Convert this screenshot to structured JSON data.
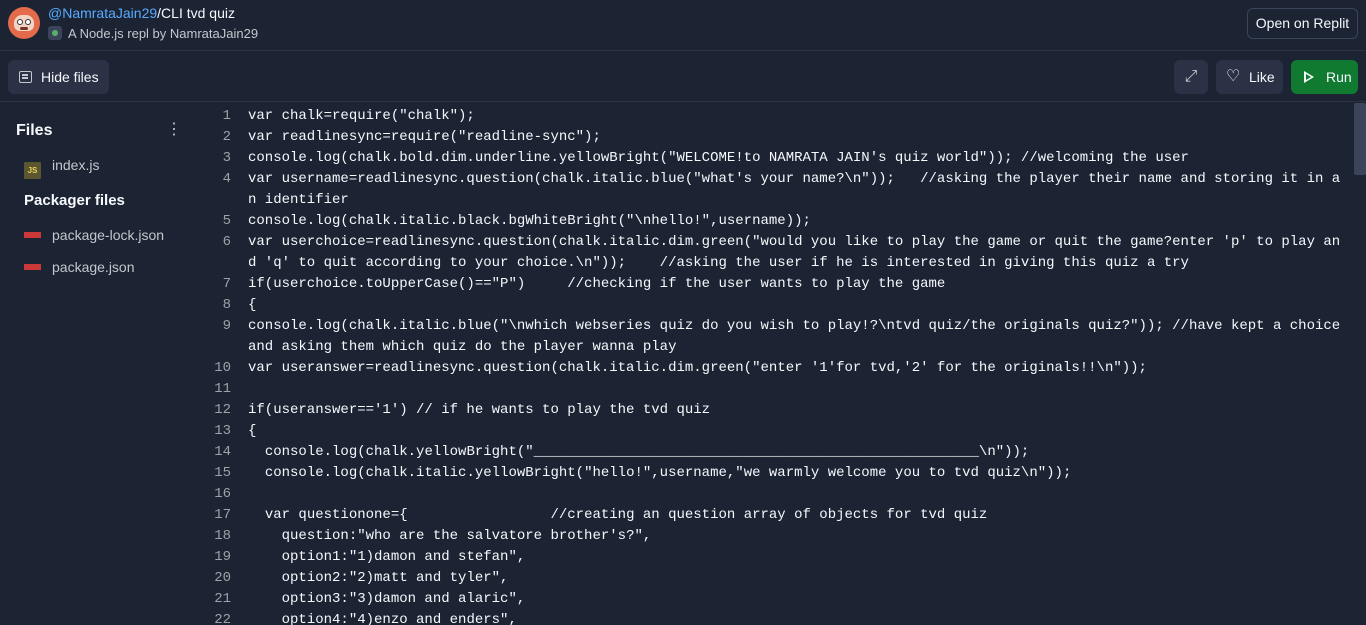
{
  "header": {
    "user": "@NamrataJain29",
    "repl_name": "/CLI tvd quiz",
    "subtitle": "A Node.js repl by NamrataJain29",
    "open_label": "Open on Replit"
  },
  "toolbar": {
    "hide_files_label": "Hide files",
    "like_label": "Like",
    "run_label": "Run"
  },
  "sidebar": {
    "files_heading": "Files",
    "files": [
      {
        "name": "index.js",
        "icon": "js-file-icon"
      }
    ],
    "packager_heading": "Packager files",
    "packager_files": [
      {
        "name": "package-lock.json",
        "icon": "npm-icon"
      },
      {
        "name": "package.json",
        "icon": "npm-icon"
      }
    ]
  },
  "editor": {
    "line_numbers": [
      "1",
      "2",
      "3",
      "4",
      "5",
      "6",
      "7",
      "8",
      "9",
      "10",
      "11",
      "12",
      "13",
      "14",
      "15",
      "16",
      "17",
      "18",
      "19",
      "20",
      "21",
      "22"
    ],
    "lines": [
      "var chalk=require(\"chalk\");",
      "var readlinesync=require(\"readline-sync\");",
      "console.log(chalk.bold.dim.underline.yellowBright(\"WELCOME!to NAMRATA JAIN's quiz world\")); //welcoming the user",
      "var username=readlinesync.question(chalk.italic.blue(\"what's your name?\\n\"));   //asking the player their name and storing it in an identifier",
      "console.log(chalk.italic.black.bgWhiteBright(\"\\nhello!\",username));",
      "var userchoice=readlinesync.question(chalk.italic.dim.green(\"would you like to play the game or quit the game?enter 'p' to play and 'q' to quit according to your choice.\\n\"));    //asking the user if he is interested in giving this quiz a try",
      "if(userchoice.toUpperCase()==\"P\")     //checking if the user wants to play the game",
      "{",
      "console.log(chalk.italic.blue(\"\\nwhich webseries quiz do you wish to play!?\\ntvd quiz/the originals quiz?\")); //have kept a choice and asking them which quiz do the player wanna play",
      "var useranswer=readlinesync.question(chalk.italic.dim.green(\"enter '1'for tvd,'2' for the originals!!\\n\"));",
      "",
      "if(useranswer=='1') // if he wants to play the tvd quiz",
      "{",
      "  console.log(chalk.yellowBright(\"_____________________________________________________\\n\"));",
      "  console.log(chalk.italic.yellowBright(\"hello!\",username,\"we warmly welcome you to tvd quiz\\n\"));",
      "",
      "  var questionone={                 //creating an question array of objects for tvd quiz",
      "    question:\"who are the salvatore brother's?\",",
      "    option1:\"1)damon and stefan\",",
      "    option2:\"2)matt and tyler\",",
      "    option3:\"3)damon and alaric\",",
      "    option4:\"4)enzo and enders\","
    ]
  }
}
